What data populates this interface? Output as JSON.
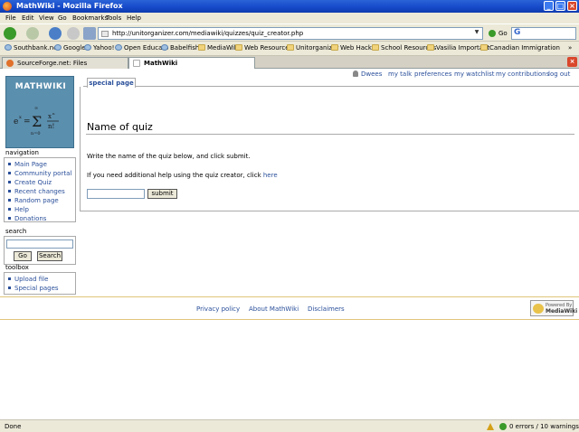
{
  "window": {
    "title": "MathWiki - Mozilla Firefox"
  },
  "menu": [
    "File",
    "Edit",
    "View",
    "Go",
    "Bookmarks",
    "Tools",
    "Help"
  ],
  "address": {
    "url": "http://unitorganizer.com/mediawiki/quizzes/quiz_creator.php",
    "go_label": "Go",
    "search_placeholder": ""
  },
  "bookmarks": [
    "Southbank.net",
    "Google",
    "Yahoo!",
    "Open Educato",
    "Babelfish",
    "MediaWiki",
    "Web Resources",
    "Unitorganizer",
    "Web Hacks",
    "School Resources",
    "Vasilia Important",
    "Canadian Immigration"
  ],
  "tabs": [
    {
      "label": "SourceForge.net: Files",
      "active": false
    },
    {
      "label": "MathWiki",
      "active": true
    }
  ],
  "user_links": [
    "Dwees",
    "my talk",
    "preferences",
    "my watchlist",
    "my contributions",
    "log out"
  ],
  "logo": {
    "title": "MATHWIKI"
  },
  "sidebar": {
    "navigation": {
      "heading": "navigation",
      "items": [
        "Main Page",
        "Community portal",
        "Create Quiz",
        "Recent changes",
        "Random page",
        "Help",
        "Donations"
      ]
    },
    "search": {
      "heading": "search",
      "go": "Go",
      "search": "Search"
    },
    "toolbox": {
      "heading": "toolbox",
      "items": [
        "Upload file",
        "Special pages"
      ]
    }
  },
  "content": {
    "tab": "special page",
    "heading": "Name of quiz",
    "instruction": "Write the name of the quiz below, and click submit.",
    "help_prefix": "If you need additional help using the quiz creator, click ",
    "help_link": "here",
    "submit": "submit"
  },
  "footer": {
    "links": [
      "Privacy policy",
      "About MathWiki",
      "Disclaimers"
    ],
    "badge": {
      "line1": "Powered By",
      "line2": "MediaWiki"
    }
  },
  "status": {
    "left": "Done",
    "right": "0 errors / 10 warnings"
  },
  "colors": {
    "link": "#2a4f9a",
    "logo_bg": "#5b8fae",
    "titlebar": "#1548c8"
  }
}
